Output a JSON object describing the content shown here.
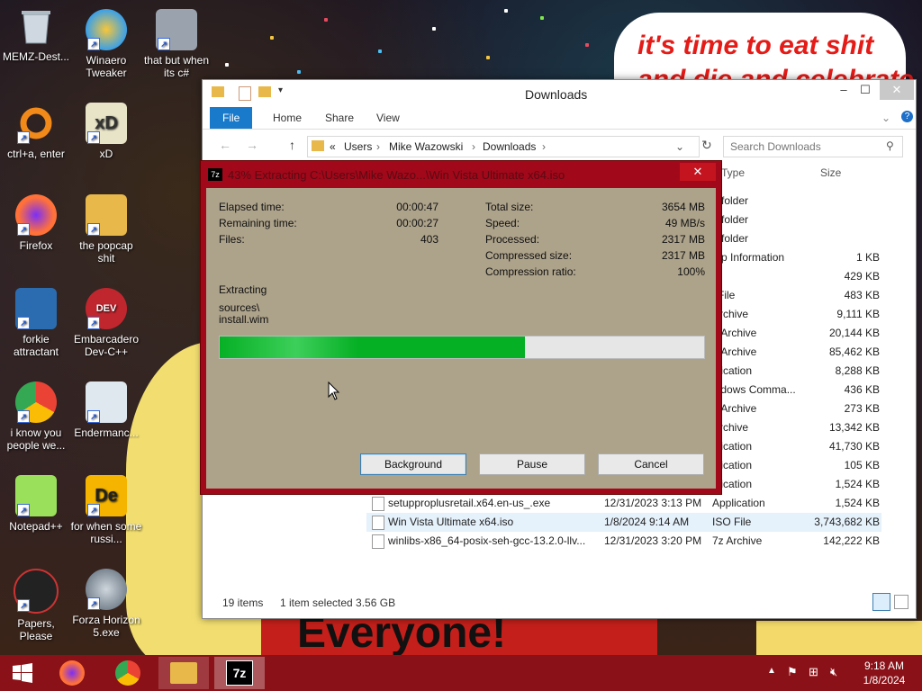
{
  "desktop": {
    "icons": [
      {
        "label": "MEMZ-Dest..."
      },
      {
        "label": "Winaero Tweaker"
      },
      {
        "label": "that but when its c#"
      },
      {
        "label": "ctrl+a, enter"
      },
      {
        "label": "xD"
      },
      {
        "label": "Firefox"
      },
      {
        "label": "the popcap shit"
      },
      {
        "label": "forkie attractant"
      },
      {
        "label": "Embarcadero Dev-C++"
      },
      {
        "label": "i know you people we..."
      },
      {
        "label": "Endermanc..."
      },
      {
        "label": "Notepad++"
      },
      {
        "label": "for when some russi..."
      },
      {
        "label": "Papers, Please"
      },
      {
        "label": "Forza Horizon 5.exe"
      }
    ],
    "wallpaper_text": {
      "top_line": "it's time to eat shit",
      "top_line_2": "and die and celebrate",
      "bottom": "Everyone!"
    }
  },
  "explorer": {
    "title": "Downloads",
    "tabs": [
      "File",
      "Home",
      "Share",
      "View"
    ],
    "breadcrumb": [
      "Users",
      "Mike Wazowski",
      "Downloads"
    ],
    "search_placeholder": "Search Downloads",
    "columns": {
      "type": "Type",
      "size": "Size"
    },
    "rows": [
      {
        "name": "",
        "date": "",
        "type": "e folder",
        "size": ""
      },
      {
        "name": "",
        "date": "",
        "type": "e folder",
        "size": ""
      },
      {
        "name": "",
        "date": "",
        "type": "e folder",
        "size": ""
      },
      {
        "name": "",
        "date": "",
        "type": "tup Information",
        "size": "1 KB"
      },
      {
        "name": "",
        "date": "",
        "type": "e",
        "size": "429 KB"
      },
      {
        "name": "",
        "date": "",
        "type": "l File",
        "size": "483 KB"
      },
      {
        "name": "",
        "date": "",
        "type": "Archive",
        "size": "9,111 KB"
      },
      {
        "name": "",
        "date": "",
        "type": "o Archive",
        "size": "20,144 KB"
      },
      {
        "name": "",
        "date": "",
        "type": "o Archive",
        "size": "85,462 KB"
      },
      {
        "name": "",
        "date": "",
        "type": "plication",
        "size": "8,288 KB"
      },
      {
        "name": "",
        "date": "",
        "type": "indows Comma...",
        "size": "436 KB"
      },
      {
        "name": "",
        "date": "",
        "type": "o Archive",
        "size": "273 KB"
      },
      {
        "name": "",
        "date": "",
        "type": "Archive",
        "size": "13,342 KB"
      },
      {
        "name": "",
        "date": "",
        "type": "plication",
        "size": "41,730 KB"
      },
      {
        "name": "",
        "date": "",
        "type": "plication",
        "size": "105 KB"
      },
      {
        "name": "",
        "date": "",
        "type": "plication",
        "size": "1,524 KB"
      },
      {
        "name": "setupproplusretail.x64.en-us_.exe",
        "date": "12/31/2023 3:13 PM",
        "type": "Application",
        "size": "1,524 KB"
      },
      {
        "name": "Win Vista Ultimate x64.iso",
        "date": "1/8/2024 9:14 AM",
        "type": "ISO File",
        "size": "3,743,682 KB"
      },
      {
        "name": "winlibs-x86_64-posix-seh-gcc-13.2.0-llv...",
        "date": "12/31/2023 3:20 PM",
        "type": "7z Archive",
        "size": "142,222 KB"
      }
    ],
    "status": {
      "items": "19 items",
      "selected": "1 item selected  3.56 GB"
    }
  },
  "dialog": {
    "title": "43% Extracting C:\\Users\\Mike Wazo...\\Win Vista Ultimate x64.iso",
    "app_badge": "7z",
    "stats_left": [
      {
        "label": "Elapsed time:",
        "value": "00:00:47"
      },
      {
        "label": "Remaining time:",
        "value": "00:00:27"
      },
      {
        "label": "Files:",
        "value": "403"
      }
    ],
    "stats_right": [
      {
        "label": "Total size:",
        "value": "3654 MB"
      },
      {
        "label": "Speed:",
        "value": "49 MB/s"
      },
      {
        "label": "Processed:",
        "value": "2317 MB"
      },
      {
        "label": "Compressed size:",
        "value": "2317 MB"
      },
      {
        "label": "Compression ratio:",
        "value": "100%"
      }
    ],
    "operation": "Extracting",
    "current_file_1": "sources\\",
    "current_file_2": "install.wim",
    "progress": 0.63,
    "buttons": {
      "background": "Background",
      "pause": "Pause",
      "cancel": "Cancel"
    }
  },
  "taskbar": {
    "time": "9:18 AM",
    "date": "1/8/2024",
    "apps": [
      "start-button",
      "firefox",
      "chrome",
      "file-explorer",
      "7zip"
    ]
  }
}
